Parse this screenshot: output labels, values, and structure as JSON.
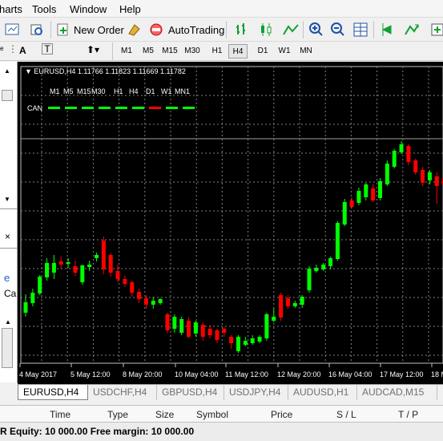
{
  "menu": [
    "harts",
    "Tools",
    "Window",
    "Help"
  ],
  "toolbar": {
    "new_order": "New Order",
    "autotrading": "AutoTrading"
  },
  "timeframes": [
    "M1",
    "M5",
    "M15",
    "M30",
    "H1",
    "H4",
    "D1",
    "W1",
    "MN"
  ],
  "active_timeframe": "H4",
  "left_panel": {
    "frag1": "e",
    "frag2": "Ca"
  },
  "chart": {
    "header": "EURUSD,H4  1.11766 1.11823 1.11669 1.11782",
    "indicator_tf_labels": [
      "M1",
      "M5",
      "M15",
      "M30",
      "H1",
      "H4",
      "D1",
      "W1",
      "MN1"
    ],
    "indicator_name": "CAN",
    "indicator_states": [
      "green",
      "green",
      "green",
      "green",
      "green",
      "green",
      "red",
      "green",
      "green"
    ],
    "x_labels": [
      "4 May 2017",
      "5 May 12:00",
      "8 May 20:00",
      "10 May 04:00",
      "11 May 12:00",
      "12 May 20:00",
      "16 May 04:00",
      "17 May 12:00",
      "18 M"
    ],
    "colors": {
      "up": "#00ff00",
      "down": "#ff0000",
      "grid": "#c0c0c0",
      "text": "#ffffff"
    },
    "candles": [
      {
        "o": 377,
        "c": 390,
        "h": 395,
        "l": 367,
        "up": true
      },
      {
        "o": 365,
        "c": 378,
        "h": 382,
        "l": 360,
        "up": true
      },
      {
        "o": 345,
        "c": 366,
        "h": 368,
        "l": 343,
        "up": true
      },
      {
        "o": 328,
        "c": 346,
        "h": 350,
        "l": 322,
        "up": true
      },
      {
        "o": 328,
        "c": 340,
        "h": 348,
        "l": 318,
        "up": true
      },
      {
        "o": 330,
        "c": 326,
        "h": 335,
        "l": 320,
        "up": false
      },
      {
        "o": 327,
        "c": 329,
        "h": 334,
        "l": 322,
        "up": true
      },
      {
        "o": 340,
        "c": 332,
        "h": 344,
        "l": 325,
        "up": false
      },
      {
        "o": 352,
        "c": 331,
        "h": 355,
        "l": 330,
        "up": true
      },
      {
        "o": 333,
        "c": 330,
        "h": 338,
        "l": 325,
        "up": true
      },
      {
        "o": 322,
        "c": 318,
        "h": 326,
        "l": 315,
        "up": true
      },
      {
        "o": 300,
        "c": 336,
        "h": 342,
        "l": 295,
        "up": false
      },
      {
        "o": 318,
        "c": 340,
        "h": 345,
        "l": 316,
        "up": false
      },
      {
        "o": 338,
        "c": 348,
        "h": 352,
        "l": 330,
        "up": false
      },
      {
        "o": 348,
        "c": 354,
        "h": 358,
        "l": 344,
        "up": false
      },
      {
        "o": 352,
        "c": 365,
        "h": 370,
        "l": 350,
        "up": false
      },
      {
        "o": 364,
        "c": 373,
        "h": 378,
        "l": 360,
        "up": false
      },
      {
        "o": 372,
        "c": 380,
        "h": 385,
        "l": 368,
        "up": false
      },
      {
        "o": 380,
        "c": 375,
        "h": 385,
        "l": 370,
        "up": true
      },
      {
        "o": 378,
        "c": 373,
        "h": 380,
        "l": 372,
        "up": true
      },
      {
        "o": 392,
        "c": 412,
        "h": 415,
        "l": 390,
        "up": false
      },
      {
        "o": 395,
        "c": 410,
        "h": 415,
        "l": 392,
        "up": true
      },
      {
        "o": 398,
        "c": 415,
        "h": 418,
        "l": 395,
        "up": true
      },
      {
        "o": 400,
        "c": 420,
        "h": 422,
        "l": 396,
        "up": false
      },
      {
        "o": 402,
        "c": 416,
        "h": 420,
        "l": 400,
        "up": true
      },
      {
        "o": 405,
        "c": 420,
        "h": 425,
        "l": 402,
        "up": false
      },
      {
        "o": 410,
        "c": 418,
        "h": 422,
        "l": 405,
        "up": false
      },
      {
        "o": 412,
        "c": 424,
        "h": 428,
        "l": 410,
        "up": false
      },
      {
        "o": 415,
        "c": 410,
        "h": 420,
        "l": 408,
        "up": false
      },
      {
        "o": 420,
        "c": 428,
        "h": 435,
        "l": 418,
        "up": false
      },
      {
        "o": 420,
        "c": 438,
        "h": 440,
        "l": 418,
        "up": true
      },
      {
        "o": 425,
        "c": 430,
        "h": 432,
        "l": 420,
        "up": true
      },
      {
        "o": 422,
        "c": 428,
        "h": 430,
        "l": 418,
        "up": true
      },
      {
        "o": 420,
        "c": 426,
        "h": 428,
        "l": 418,
        "up": true
      },
      {
        "o": 392,
        "c": 422,
        "h": 425,
        "l": 390,
        "up": true
      },
      {
        "o": 395,
        "c": 400,
        "h": 402,
        "l": 385,
        "up": true
      },
      {
        "o": 368,
        "c": 396,
        "h": 400,
        "l": 365,
        "up": false
      },
      {
        "o": 372,
        "c": 382,
        "h": 385,
        "l": 368,
        "up": false
      },
      {
        "o": 378,
        "c": 382,
        "h": 384,
        "l": 375,
        "up": true
      },
      {
        "o": 370,
        "c": 380,
        "h": 384,
        "l": 368,
        "up": true
      },
      {
        "o": 335,
        "c": 362,
        "h": 365,
        "l": 332,
        "up": true
      },
      {
        "o": 334,
        "c": 338,
        "h": 340,
        "l": 330,
        "up": true
      },
      {
        "o": 330,
        "c": 336,
        "h": 338,
        "l": 328,
        "up": true
      },
      {
        "o": 322,
        "c": 332,
        "h": 336,
        "l": 320,
        "up": true
      },
      {
        "o": 278,
        "c": 323,
        "h": 325,
        "l": 276,
        "up": true
      },
      {
        "o": 252,
        "c": 280,
        "h": 282,
        "l": 248,
        "up": true
      },
      {
        "o": 250,
        "c": 258,
        "h": 260,
        "l": 246,
        "up": false
      },
      {
        "o": 238,
        "c": 253,
        "h": 256,
        "l": 234,
        "up": true
      },
      {
        "o": 230,
        "c": 246,
        "h": 250,
        "l": 228,
        "up": true
      },
      {
        "o": 235,
        "c": 250,
        "h": 252,
        "l": 230,
        "up": false
      },
      {
        "o": 226,
        "c": 247,
        "h": 250,
        "l": 222,
        "up": true
      },
      {
        "o": 204,
        "c": 230,
        "h": 232,
        "l": 200,
        "up": true
      },
      {
        "o": 188,
        "c": 208,
        "h": 210,
        "l": 186,
        "up": true
      },
      {
        "o": 180,
        "c": 190,
        "h": 192,
        "l": 176,
        "up": true
      },
      {
        "o": 182,
        "c": 202,
        "h": 206,
        "l": 180,
        "up": false
      },
      {
        "o": 200,
        "c": 215,
        "h": 218,
        "l": 198,
        "up": false
      },
      {
        "o": 212,
        "c": 228,
        "h": 232,
        "l": 208,
        "up": false
      },
      {
        "o": 215,
        "c": 225,
        "h": 230,
        "l": 212,
        "up": true
      },
      {
        "o": 220,
        "c": 232,
        "h": 254,
        "l": 215,
        "up": false
      },
      {
        "o": 222,
        "c": 230,
        "h": 240,
        "l": 218,
        "up": false
      }
    ]
  },
  "tabs": [
    "EURUSD,H4",
    "USDCHF,H4",
    "GBPUSD,H4",
    "USDJPY,H4",
    "AUDUSD,H1",
    "AUDCAD,M15"
  ],
  "active_tab": 0,
  "terminal": {
    "columns": [
      "Time",
      "Type",
      "Size",
      "Symbol",
      "Price",
      "S / L",
      "T / P"
    ],
    "status": "R  Equity: 10 000.00  Free margin: 10 000.00"
  }
}
